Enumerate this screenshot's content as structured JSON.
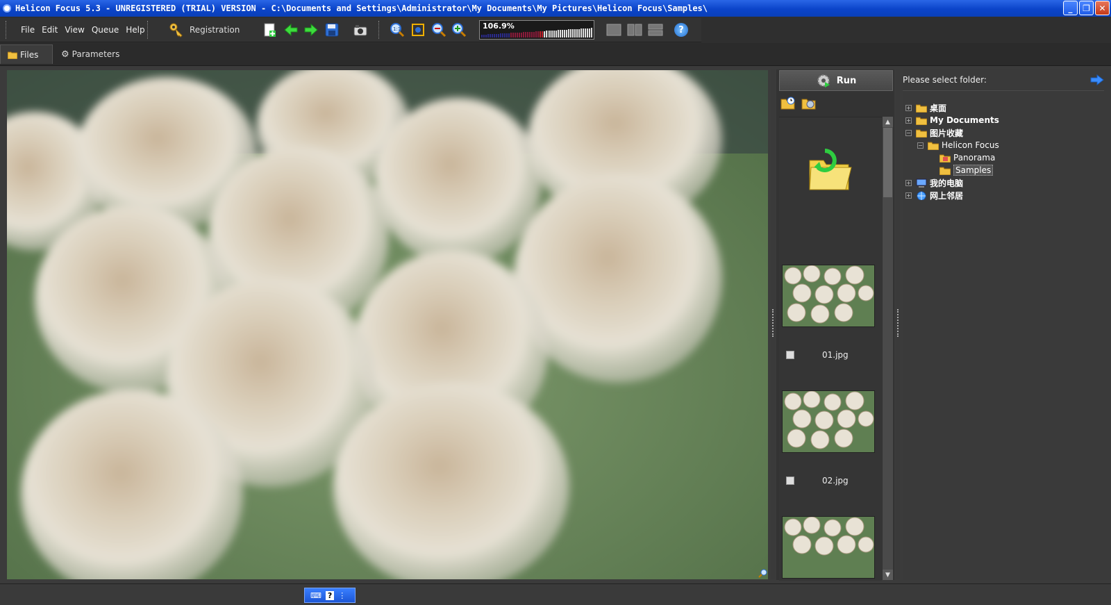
{
  "window": {
    "title": "Helicon Focus 5.3 - UNREGISTERED (TRIAL) VERSION - C:\\Documents and Settings\\Administrator\\My Documents\\My Pictures\\Helicon Focus\\Samples\\",
    "buttons": {
      "minimize": "_",
      "restore": "❐",
      "close": "✕"
    }
  },
  "menu": [
    "File",
    "Edit",
    "View",
    "Queue",
    "Help"
  ],
  "toolbar": {
    "registration_label": "Registration",
    "zoom_value": "106.9%",
    "help_label": "?"
  },
  "tabs": {
    "files": "Files",
    "parameters": "Parameters"
  },
  "run_button": {
    "label": "Run"
  },
  "files": [
    {
      "name": "01.jpg",
      "checked": false
    },
    {
      "name": "02.jpg",
      "checked": false
    }
  ],
  "folder_panel": {
    "prompt": "Please select folder:",
    "tree": [
      {
        "label": "桌面",
        "depth": 0,
        "expander": "+",
        "icon": "folder-icon"
      },
      {
        "label": "My Documents",
        "depth": 0,
        "expander": "+",
        "icon": "folder-icon"
      },
      {
        "label": "图片收藏",
        "depth": 0,
        "expander": "−",
        "icon": "folder-icon"
      },
      {
        "label": "Helicon Focus",
        "depth": 1,
        "expander": "−",
        "icon": "folder-icon"
      },
      {
        "label": "Panorama",
        "depth": 2,
        "expander": "",
        "icon": "image-folder-icon"
      },
      {
        "label": "Samples",
        "depth": 2,
        "expander": "",
        "icon": "folder-icon",
        "selected": true
      },
      {
        "label": "我的电脑",
        "depth": 0,
        "expander": "+",
        "icon": "computer-icon"
      },
      {
        "label": "网上邻居",
        "depth": 0,
        "expander": "+",
        "icon": "network-icon"
      }
    ]
  },
  "statusbar": {
    "ime_help": "?"
  },
  "colors": {
    "titlebar": "#0b44c9",
    "panel_bg": "#3a3a3a",
    "toolbar_bg": "#333333",
    "accent_green": "#2ecc40",
    "help_blue": "#1e6cd0"
  }
}
